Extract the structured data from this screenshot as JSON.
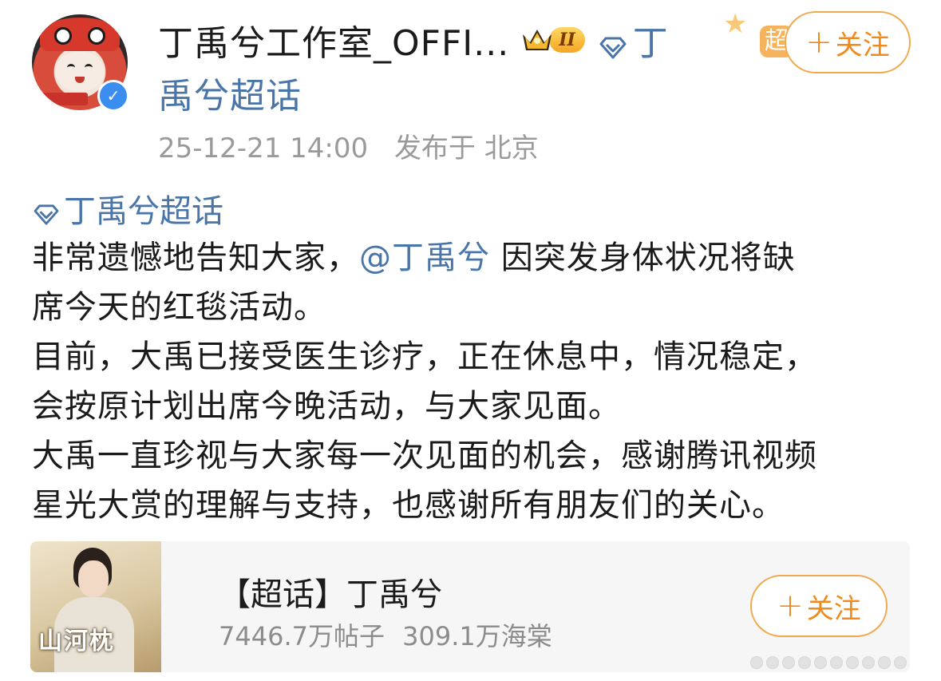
{
  "header": {
    "name": "丁禹兮工作室_OFFI...",
    "vip_level": "II",
    "topic_inline_part1": "丁",
    "topic_inline_part2": "禹兮超话",
    "follow_label": "关注",
    "super_text": "超"
  },
  "meta": {
    "time": "25-12-21 14:00",
    "location": "发布于 北京"
  },
  "post": {
    "topic_tag": "丁禹兮超话",
    "line1_before": "非常遗憾地告知大家，",
    "mention": "@丁禹兮",
    "line1_after": " 因突发身体状况将缺",
    "line2": "席今天的红毯活动。",
    "line3": "目前，大禹已接受医生诊疗，正在休息中，情况稳定，",
    "line4": "会按原计划出席今晚活动，与大家见面。",
    "line5": "大禹一直珍视与大家每一次见面的机会，感谢腾讯视频",
    "line6": "星光大赏的理解与支持，也感谢所有朋友们的关心。"
  },
  "topic_card": {
    "title": "【超话】丁禹兮",
    "posts": "7446.7万帖子",
    "fans": "309.1万海棠",
    "thumb_title": "山河枕",
    "follow_label": "关注"
  },
  "icons": {
    "verified": "verified-check-icon",
    "topic": "diamond-topic-icon",
    "crown": "crown-icon",
    "plus": "plus-icon"
  },
  "colors": {
    "link": "#4a75a8",
    "follow": "#f08a1c",
    "follow_border": "#f0a94d",
    "meta": "#9a9a9a",
    "verified": "#3b8ef0"
  }
}
